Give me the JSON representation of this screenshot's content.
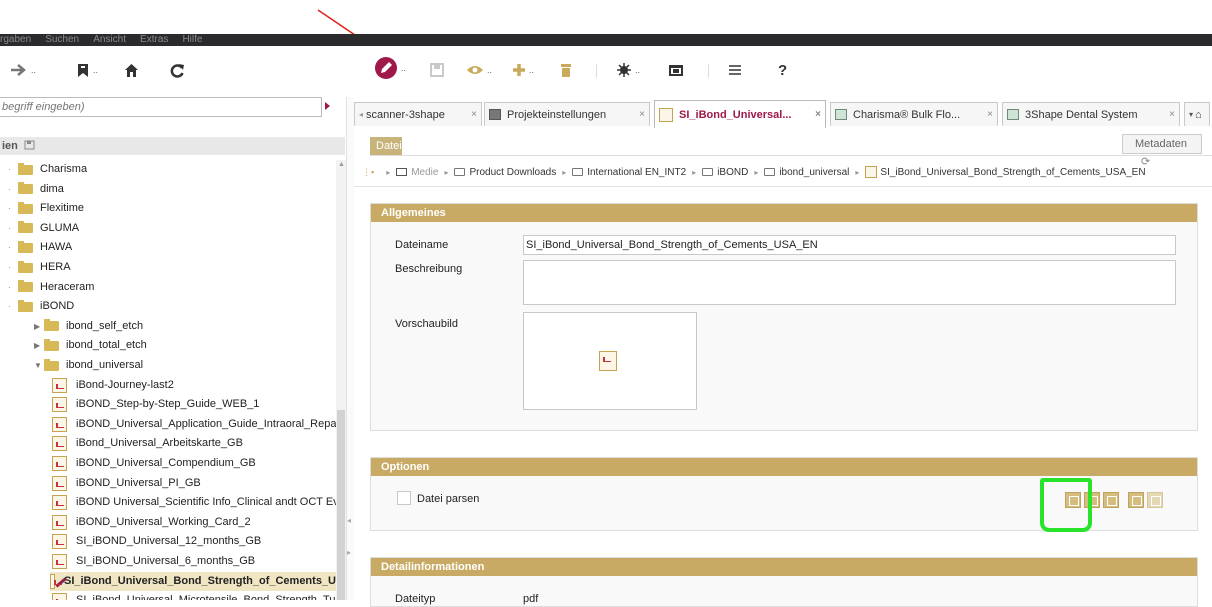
{
  "menu": [
    "rgaben",
    "Suchen",
    "Ansicht",
    "Extras",
    "Hilfe"
  ],
  "toolbar": {
    "dots": "..",
    "help_label": "?"
  },
  "search": {
    "placeholder": "begriff eingeben)"
  },
  "left_pane": {
    "header": "ien",
    "tree": [
      {
        "type": "folder",
        "label": "Charisma",
        "level": 0
      },
      {
        "type": "folder",
        "label": "dima",
        "level": 0
      },
      {
        "type": "folder",
        "label": "Flexitime",
        "level": 0
      },
      {
        "type": "folder",
        "label": "GLUMA",
        "level": 0
      },
      {
        "type": "folder",
        "label": "HAWA",
        "level": 0
      },
      {
        "type": "folder",
        "label": "HERA",
        "level": 0
      },
      {
        "type": "folder",
        "label": "Heraceram",
        "level": 0
      },
      {
        "type": "folder",
        "label": "iBOND",
        "level": 0
      },
      {
        "type": "folder",
        "label": "ibond_self_etch",
        "level": 1
      },
      {
        "type": "folder",
        "label": "ibond_total_etch",
        "level": 1
      },
      {
        "type": "folder",
        "label": "ibond_universal",
        "level": 1,
        "expanded": true
      },
      {
        "type": "pdf",
        "label": "iBond-Journey-last2",
        "level": 2
      },
      {
        "type": "pdf",
        "label": "iBOND_Step-by-Step_Guide_WEB_1",
        "level": 2
      },
      {
        "type": "pdf",
        "label": "iBOND_Universal_Application_Guide_Intraoral_Repair_C",
        "level": 2
      },
      {
        "type": "pdf",
        "label": "iBond_Universal_Arbeitskarte_GB",
        "level": 2
      },
      {
        "type": "pdf",
        "label": "iBOND_Universal_Compendium_GB",
        "level": 2
      },
      {
        "type": "pdf",
        "label": "iBOND_Universal_PI_GB",
        "level": 2
      },
      {
        "type": "pdf",
        "label": "iBOND Universal_Scientific Info_Clinical andt OCT Evalu",
        "level": 2
      },
      {
        "type": "pdf",
        "label": "iBOND_Universal_Working_Card_2",
        "level": 2
      },
      {
        "type": "pdf",
        "label": "SI_iBOND_Universal_12_months_GB",
        "level": 2
      },
      {
        "type": "pdf",
        "label": "SI_iBOND_Universal_6_months_GB",
        "level": 2
      },
      {
        "type": "pdf-edit",
        "label": "SI_iBond_Universal_Bond_Strength_of_Cements_U",
        "level": 2,
        "selected": true
      },
      {
        "type": "pdf",
        "label": "SI_iBond_Universal_Microtensile_Bond_Strength_Turke",
        "level": 2
      }
    ]
  },
  "tabs": [
    {
      "label": "scanner-3shape",
      "icon": "",
      "close": "×"
    },
    {
      "label": "Projekteinstellungen",
      "icon": "gear",
      "close": "×"
    },
    {
      "label": "SI_iBond_Universal...",
      "icon": "pdf",
      "close": "×",
      "active": true
    },
    {
      "label": "Charisma® Bulk Flo...",
      "icon": "grid",
      "close": "×"
    },
    {
      "label": "3Shape Dental System",
      "icon": "grid",
      "close": "×"
    }
  ],
  "sub_tabs": {
    "datei": "Datei",
    "metadaten": "Metadaten"
  },
  "breadcrumb": [
    "Medie",
    "Product Downloads",
    "International EN_INT2",
    "iBOND",
    "ibond_universal",
    "SI_iBond_Universal_Bond_Strength_of_Cements_USA_EN"
  ],
  "allgemeines": {
    "title": "Allgemeines",
    "dateiname_label": "Dateiname",
    "dateiname_value": "SI_iBond_Universal_Bond_Strength_of_Cements_USA_EN",
    "beschreibung_label": "Beschreibung",
    "beschreibung_value": "",
    "vorschaubild_label": "Vorschaubild"
  },
  "optionen": {
    "title": "Optionen",
    "parse_label": "Datei parsen"
  },
  "detail": {
    "title": "Detailinformationen",
    "dateityp_label": "Dateityp",
    "dateityp_value": "pdf"
  },
  "colors": {
    "panel_header": "#c8aa64",
    "accent": "#a0174a",
    "annotation_red": "#e0201c",
    "annotation_green": "#27e42a"
  }
}
